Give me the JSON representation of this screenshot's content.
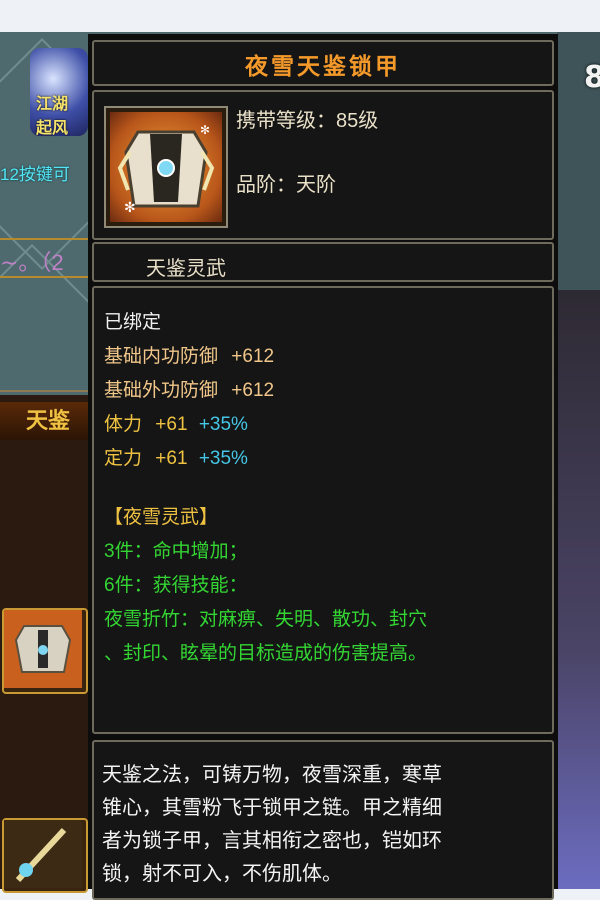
{
  "item": {
    "name": "夜雪天鉴锁甲",
    "level_label": "携带等级：85级",
    "rank_label": "品阶：天阶",
    "series_label": "天鉴灵武",
    "icon": "armor-chestplate-icon"
  },
  "stats": {
    "bound": "已绑定",
    "inner_def_label": "基础内功防御",
    "inner_def_value": "+612",
    "outer_def_label": "基础外功防御",
    "outer_def_value": "+612",
    "stamina_label": "体力",
    "stamina_value": "+61",
    "stamina_pct": "+35%",
    "focus_label": "定力",
    "focus_value": "+61",
    "focus_pct": "+35%"
  },
  "set": {
    "name": "【夜雪灵武】",
    "bonus_3": "3件：命中增加；",
    "bonus_6": "6件：获得技能：",
    "skill_line1": "夜雪折竹：对麻痹、失明、散功、封穴",
    "skill_line2": "、封印、眩晕的目标造成的伤害提高。"
  },
  "description": {
    "line1": "天鉴之法，可铸万物，夜雪深重，寒草",
    "line2": "锥心，其雪粉飞于锁甲之链。甲之精细",
    "line3": "者为锁子甲，言其相衔之密也，铠如环",
    "line4": "锁，射不可入，不伤肌体。"
  },
  "background": {
    "logo_text": "江湖 起风",
    "hint_text": "12按键可",
    "pink_text": "∼。（2",
    "banner_text": "天鉴",
    "right_number": "8"
  },
  "colors": {
    "title": "#f59a2a",
    "stat": "#f0c68a",
    "percent": "#45c6e6",
    "set": "#33d633",
    "set_name": "#f0c242"
  }
}
